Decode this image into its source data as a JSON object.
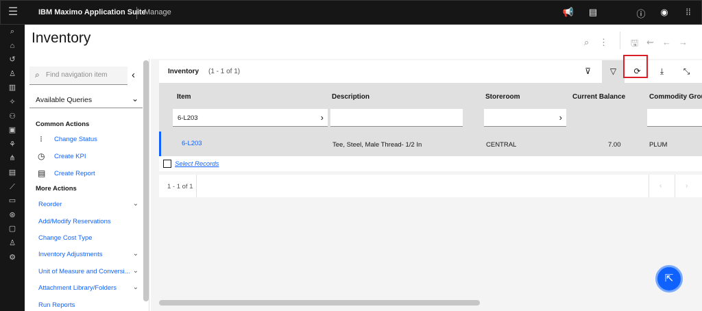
{
  "topbar": {
    "brand": "IBM Maximo Application Suite",
    "app": "Manage"
  },
  "page": {
    "title": "Inventory"
  },
  "nav": {
    "search_placeholder": "Find navigation item",
    "queries_label": "Available Queries",
    "common_actions_heading": "Common Actions",
    "common_actions": [
      "Change Status",
      "Create KPI",
      "Create Report"
    ],
    "more_actions_heading": "More Actions",
    "more_actions": [
      "Reorder",
      "Add/Modify Reservations",
      "Change Cost Type",
      "Inventory Adjustments",
      "Unit of Measure and Conversi...",
      "Attachment Library/Folders",
      "Run Reports"
    ]
  },
  "grid": {
    "title": "Inventory",
    "count": "(1 - 1 of 1)",
    "columns": [
      "Item",
      "Description",
      "Storeroom",
      "Current Balance",
      "Commodity Grou"
    ],
    "filter_item": "6-L203",
    "row": {
      "item": "6-L203",
      "description": "Tee, Steel, Male Thread- 1/2 In",
      "storeroom": "CENTRAL",
      "balance": "7.00",
      "commodity": "PLUM"
    },
    "select_records": "Select Records",
    "pagination": "1 - 1 of 1"
  },
  "colors": {
    "topbar": "#161616",
    "link": "#0f62fe",
    "highlight": "#da1e28"
  },
  "icons": [
    "menu-icon",
    "megaphone-icon",
    "clipboard-icon",
    "help-icon",
    "user-icon",
    "apps-grid-icon",
    "search-icon",
    "overflow-icon",
    "save-icon",
    "undo-icon",
    "back-arrow-icon",
    "forward-arrow-icon",
    "clear-filter-icon",
    "filter-icon",
    "refresh-icon",
    "download-icon",
    "minimize-icon",
    "chat-icon"
  ]
}
